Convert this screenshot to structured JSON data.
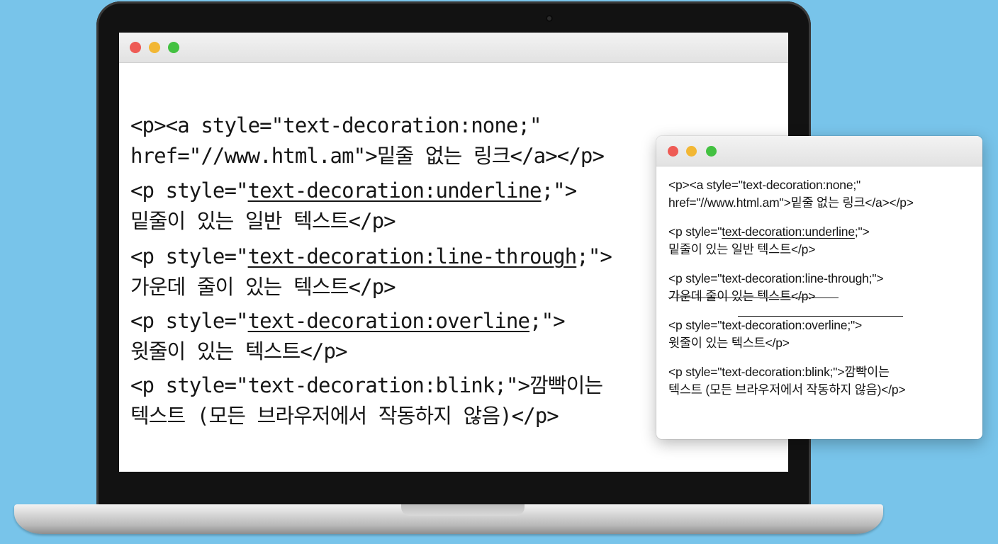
{
  "main_window": {
    "code": [
      {
        "lines": [
          {
            "pre": "<p><a style=\"text-decoration:none;\"",
            "u": "",
            "post": ""
          },
          {
            "pre": "href=\"//www.html.am\">밑줄 없는 링크</a></p>",
            "u": "",
            "post": ""
          }
        ]
      },
      {
        "lines": [
          {
            "pre": "<p style=\"",
            "u": "text-decoration:underline",
            "post": ";\">"
          },
          {
            "pre": "밑줄이 있는 일반 텍스트</p>",
            "u": "",
            "post": ""
          }
        ]
      },
      {
        "lines": [
          {
            "pre": "<p style=\"",
            "u": "text-decoration:line-through",
            "post": ";\">"
          },
          {
            "pre": "가운데 줄이 있는 텍스트</p>",
            "u": "",
            "post": ""
          }
        ]
      },
      {
        "lines": [
          {
            "pre": "<p style=\"",
            "u": "text-decoration:overline",
            "post": ";\">"
          },
          {
            "pre": "윗줄이 있는 텍스트</p>",
            "u": "",
            "post": ""
          }
        ]
      },
      {
        "lines": [
          {
            "pre": "<p style=\"text-decoration:blink;\">깜빡이는",
            "u": "",
            "post": ""
          },
          {
            "pre": "텍스트 (모든 브라우저에서 작동하지 않음)</p>",
            "u": "",
            "post": ""
          }
        ]
      }
    ]
  },
  "browser_window": {
    "paragraphs": [
      {
        "lines": [
          {
            "pre": "<p><a  style=\"text-decoration:none;\"",
            "u": "",
            "post": ""
          },
          {
            "pre": "href=\"//www.html.am\">밑줄 없는 링크</a></p>",
            "u": "",
            "post": ""
          }
        ]
      },
      {
        "lines": [
          {
            "pre": "<p  style=\"",
            "u": "text-decoration:underline",
            "post": ";\">"
          },
          {
            "pre": "밑줄이 있는 일반 텍스트</p>",
            "u": "",
            "post": ""
          }
        ]
      },
      {
        "lines": [
          {
            "pre": "<p  style=\"text-decoration:line-through;\">",
            "u": "",
            "post": ""
          },
          {
            "pre": "가운데 줄이 있는 텍스트</p>",
            "u": "",
            "post": ""
          }
        ]
      },
      {
        "lines": [
          {
            "pre": "<p  style=\"text-decoration:overline;\">",
            "u": "",
            "post": ""
          },
          {
            "pre": "윗줄이 있는 텍스트</p>",
            "u": "",
            "post": ""
          }
        ]
      },
      {
        "lines": [
          {
            "pre": "<p  style=\"text-decoration:blink;\">깜빡이는",
            "u": "",
            "post": ""
          },
          {
            "pre": "텍스트  (모든 브라우저에서 작동하지 않음)</p>",
            "u": "",
            "post": ""
          }
        ]
      }
    ]
  },
  "colors": {
    "background": "#78c4ea",
    "close_dot": "#ee5b55",
    "minimize_dot": "#f2b734",
    "zoom_dot": "#43c141"
  }
}
